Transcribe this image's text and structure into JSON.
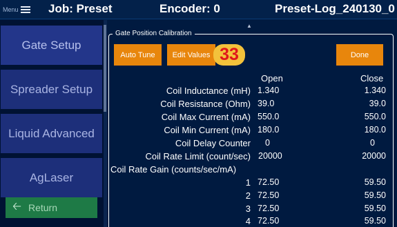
{
  "header": {
    "menu_label": "Menu",
    "job_title": "Job: Preset",
    "encoder_title": "Encoder: 0",
    "log_title": "Preset-Log_240130_0"
  },
  "sidebar": {
    "items": [
      {
        "label": "Gate Setup"
      },
      {
        "label": "Spreader Setup"
      },
      {
        "label": "Liquid Advanced"
      },
      {
        "label": "AgLaser"
      }
    ],
    "return_label": "Return"
  },
  "calibration": {
    "group_title": "Gate Position Calibration",
    "buttons": {
      "auto_tune": "Auto Tune",
      "edit_values": "Edit Values",
      "done": "Done"
    },
    "badge": "33",
    "columns": {
      "open": "Open",
      "close": "Close"
    },
    "rows": [
      {
        "label": "Coil Inductance (mH)",
        "open": "1.340",
        "close": "1.340"
      },
      {
        "label": "Coil Resistance (Ohm)",
        "open": "39.0",
        "close": "39.0"
      },
      {
        "label": "Coil Max Current (mA)",
        "open": "550.0",
        "close": "550.0"
      },
      {
        "label": "Coil Min Current (mA)",
        "open": "180.0",
        "close": "180.0"
      },
      {
        "label": "Coil Delay Counter",
        "open": "0",
        "close": "0"
      },
      {
        "label": "Coil Rate Limit (count/sec)",
        "open": "20000",
        "close": "20000"
      }
    ],
    "gain_label": "Coil Rate Gain (counts/sec/mA)",
    "gain_rows": [
      {
        "index": "1",
        "open": "72.50",
        "close": "59.50"
      },
      {
        "index": "2",
        "open": "72.50",
        "close": "59.50"
      },
      {
        "index": "3",
        "open": "72.50",
        "close": "59.50"
      },
      {
        "index": "4",
        "open": "72.50",
        "close": "59.50"
      }
    ]
  },
  "colors": {
    "background": "#001a40",
    "accent_orange": "#e8860c",
    "sidebar_button": "#1d2f7a",
    "return_button": "#1e7a46",
    "badge_fill": "#f3c23b",
    "badge_text": "#e0161b"
  },
  "icons": {
    "menu": "hamburger-icon",
    "return": "arrow-left-icon",
    "scroll_up": "caret-up-icon"
  }
}
